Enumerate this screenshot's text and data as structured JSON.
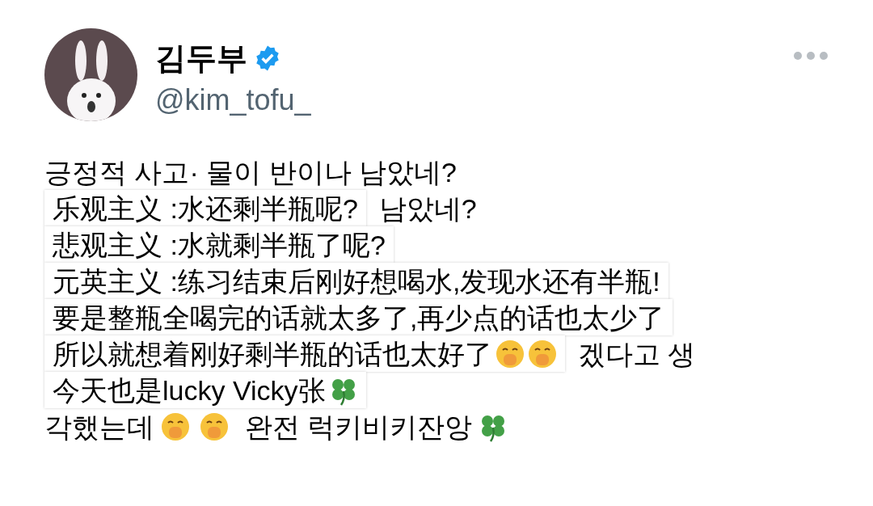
{
  "author": {
    "name": "김두부",
    "verified": true,
    "handle": "@kim_tofu_"
  },
  "lines": [
    {
      "kind": "korean",
      "text": "긍정적 사고· 물이 반이나 남았네?"
    },
    {
      "kind": "caption",
      "text": "乐观主义 :水还剩半瓶呢?",
      "behind": "남았네?"
    },
    {
      "kind": "caption",
      "text": "悲观主义 :水就剩半瓶了呢?"
    },
    {
      "kind": "caption",
      "text": "元英主义 :练习结束后刚好想喝水,发现水还有半瓶!"
    },
    {
      "kind": "caption",
      "text": "要是整瓶全喝完的话就太多了,再少点的话也太少了"
    },
    {
      "kind": "caption-laugh",
      "text": "所以就想着刚好剩半瓶的话也太好了",
      "behind": "겠다고 생"
    },
    {
      "kind": "caption-clover",
      "text": "今天也是lucky Vicky张"
    },
    {
      "kind": "korean-ending",
      "text": "각했는데",
      "tail": "완전 럭키비키잔앙"
    }
  ]
}
